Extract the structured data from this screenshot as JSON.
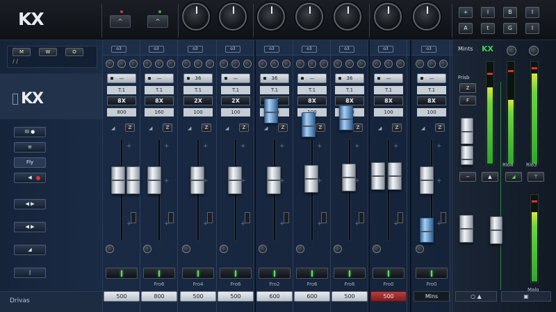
{
  "app": {
    "logo": "KX"
  },
  "top": {
    "left_buttons": [
      "^",
      "^"
    ],
    "grid_buttons": [
      "+",
      "I",
      "B",
      "I",
      "A",
      "t",
      "G",
      "I"
    ]
  },
  "left_panel": {
    "header_buttons": [
      "M",
      "W",
      "O"
    ],
    "header_sub": "∕ ∕",
    "logo": "KX",
    "buttons": [
      "III ●",
      "≡",
      "Fly",
      "◀",
      "◀ ▶",
      "◀ ▶",
      "◢",
      "|"
    ],
    "footer": "Drivas"
  },
  "channels": [
    {
      "top": "o3",
      "plugin": "—",
      "tl": "T.1",
      "ratio": "8X",
      "num": "800",
      "btn": "Z",
      "name": "",
      "footer": "500",
      "footer_style": "light"
    },
    {
      "top": "o3",
      "plugin": "—",
      "tl": "T.1",
      "ratio": "8X",
      "num": "160",
      "btn": "Z",
      "name": "Fro6",
      "footer": "800",
      "footer_style": "light"
    },
    {
      "top": "o3",
      "plugin": "36",
      "tl": "T.1",
      "ratio": "2X",
      "num": "100",
      "btn": "Z",
      "name": "Fro4",
      "footer": "500",
      "footer_style": "light"
    },
    {
      "top": "o3",
      "plugin": "—",
      "tl": "T.1",
      "ratio": "2X",
      "num": "100",
      "btn": "Z",
      "name": "Fro6",
      "footer": "500",
      "footer_style": "light"
    },
    {
      "top": "o3",
      "plugin": "36",
      "tl": "T.1",
      "ratio": "8X",
      "num": "800",
      "btn": "Z",
      "name": "Fro2",
      "footer": "600",
      "footer_style": "light"
    },
    {
      "top": "o3",
      "plugin": "—",
      "tl": "T.1",
      "ratio": "8X",
      "num": "100",
      "btn": "Z",
      "name": "Fro6",
      "footer": "600",
      "footer_style": "light"
    },
    {
      "top": "o3",
      "plugin": "36",
      "tl": "T.1",
      "ratio": "8X",
      "num": "800",
      "btn": "Z",
      "name": "Fro6",
      "footer": "500",
      "footer_style": "light"
    },
    {
      "top": "o3",
      "plugin": "—",
      "tl": "T.1",
      "ratio": "8X",
      "num": "100",
      "btn": "Z",
      "name": "Fro0",
      "footer": "500",
      "footer_style": "red"
    },
    {
      "top": "o3",
      "plugin": "—",
      "tl": "T.1",
      "ratio": "8X",
      "num": "100",
      "btn": "Z",
      "name": "Fro0",
      "footer": "Mlns",
      "footer_style": "dark"
    }
  ],
  "master": {
    "title": "Mints",
    "kx": "KX",
    "label1": "Frisb",
    "label2": "Rlo8",
    "label3": "Rlo3",
    "label4": "Malo",
    "footer_left": "○  ▲",
    "footer_right": "▣"
  },
  "colors": {
    "accent_green": "#39d452",
    "fader_blue": "#78a7d6",
    "record_red": "#e03030"
  }
}
